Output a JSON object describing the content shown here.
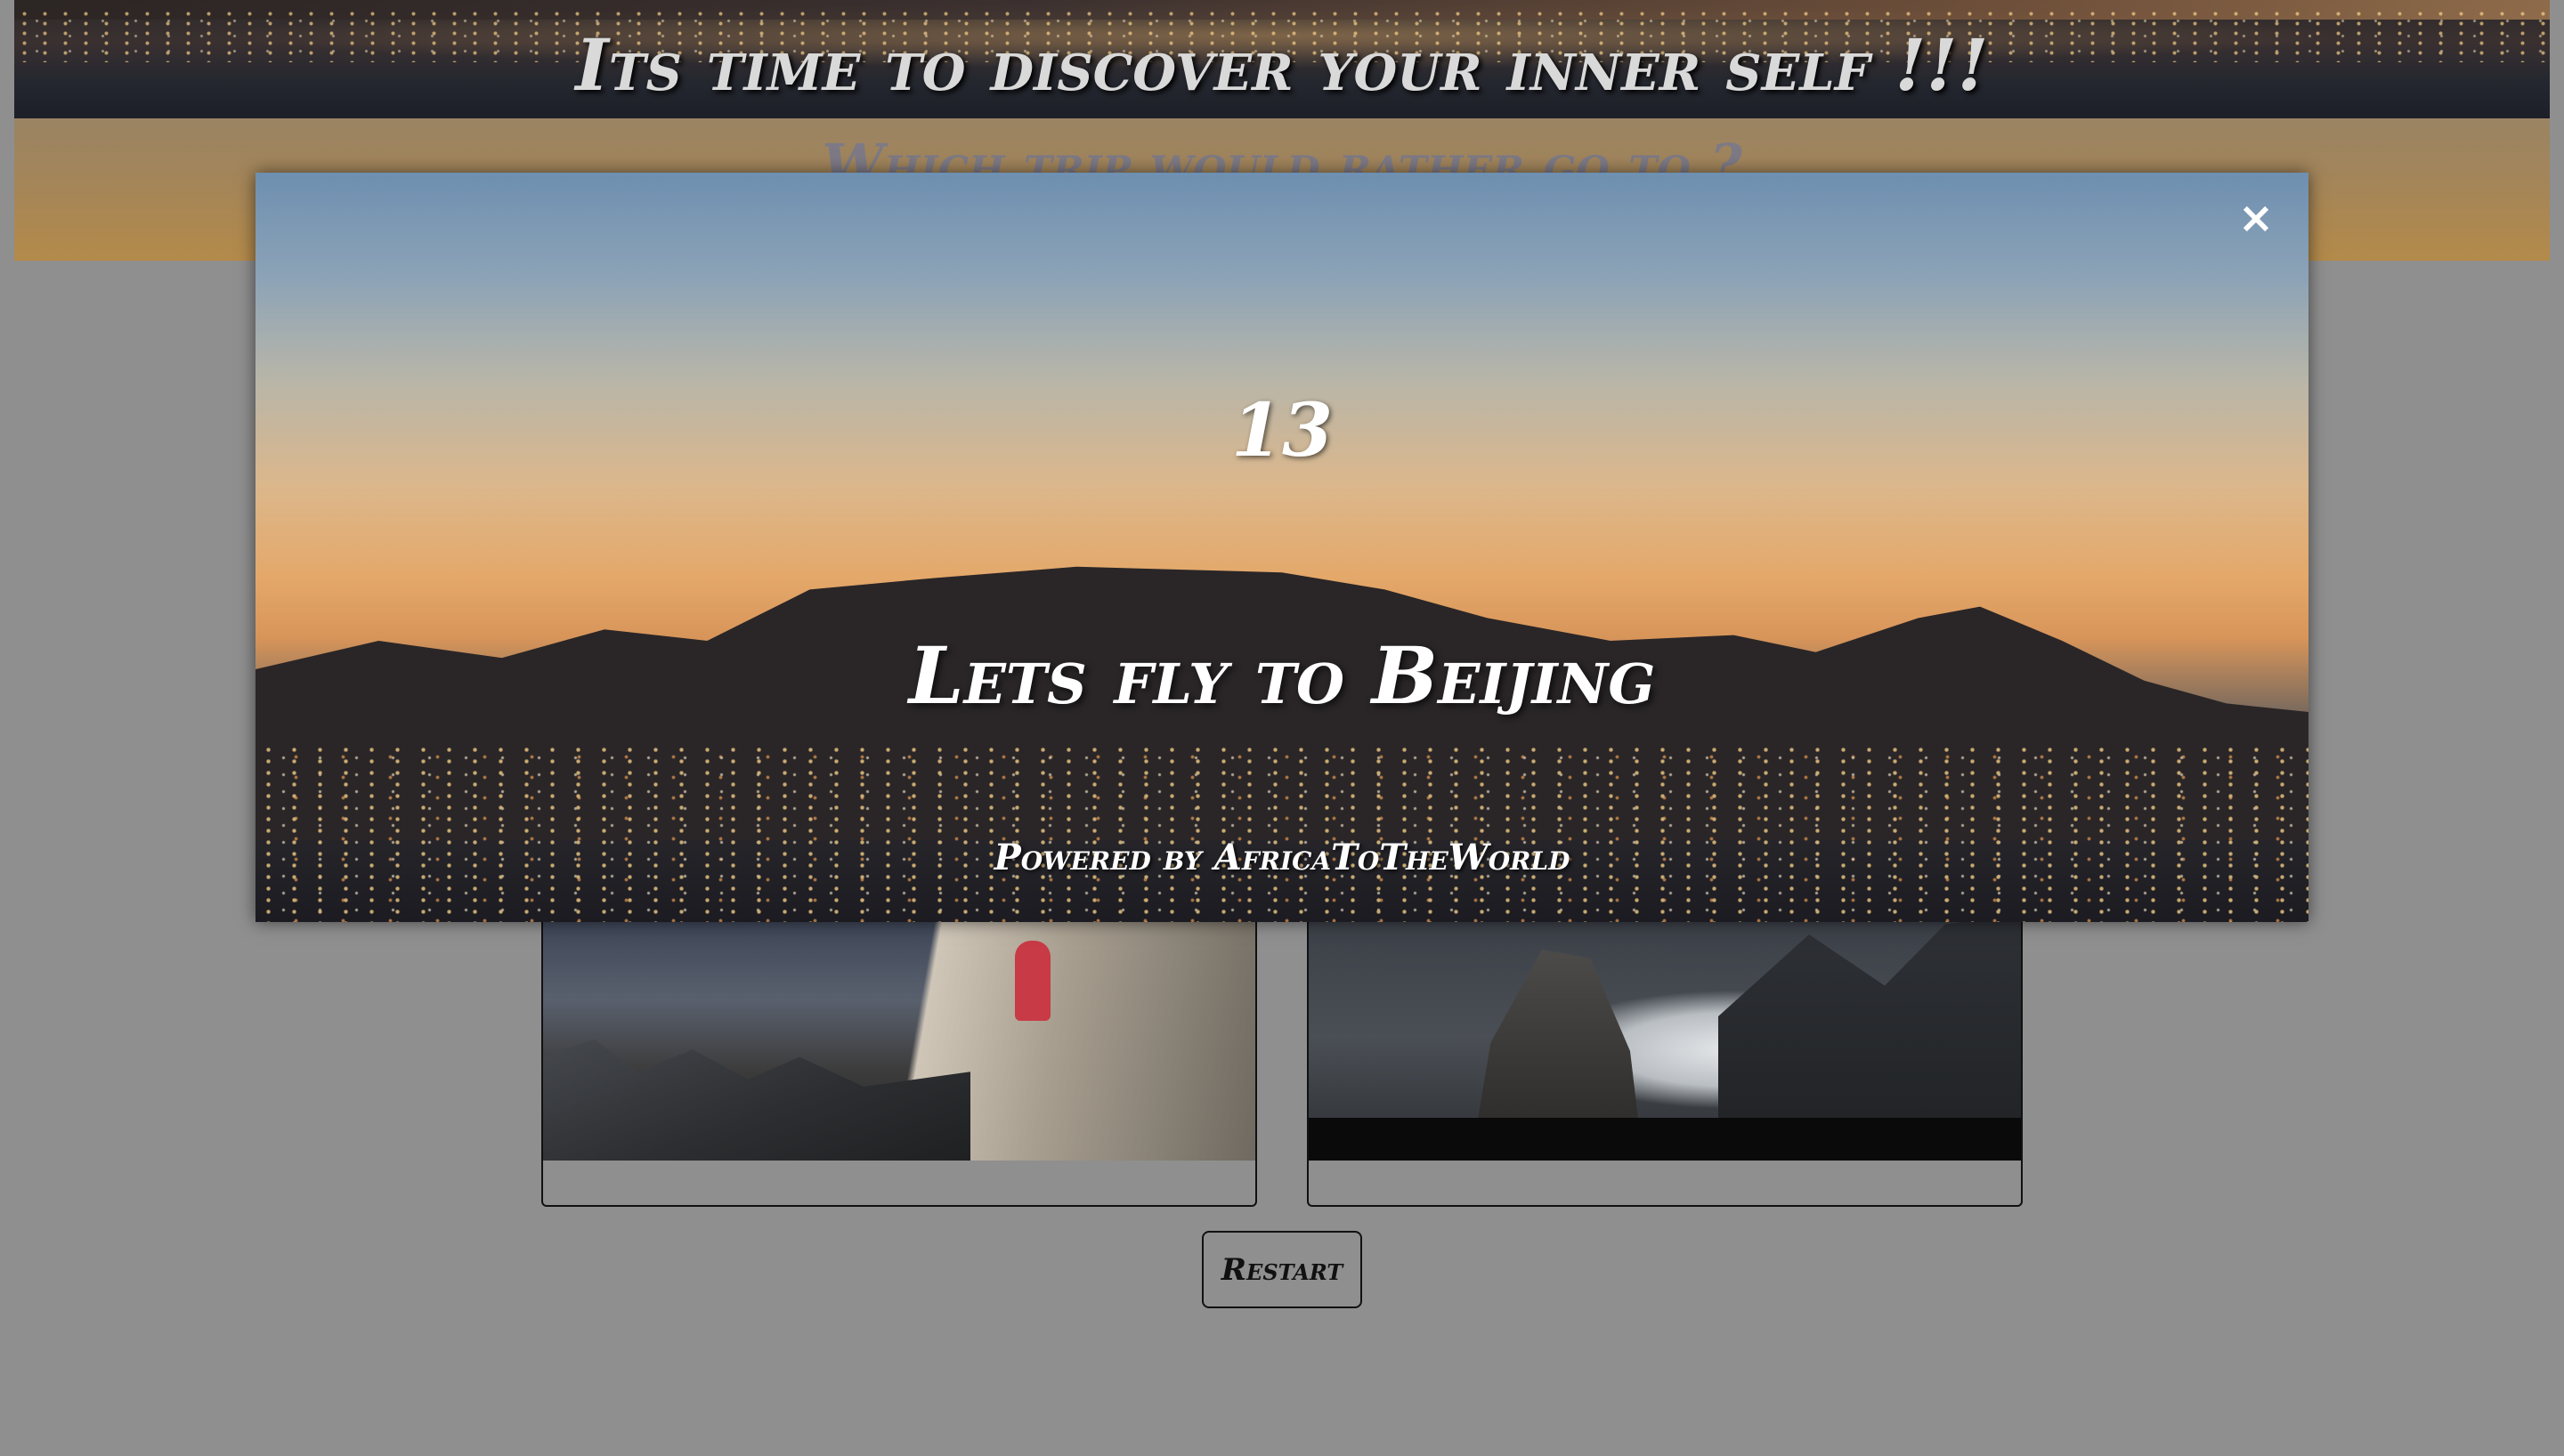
{
  "header": {
    "title": "Its time to discover your inner self !!!",
    "subtitle": "Which trip would rather go to ?"
  },
  "controls": {
    "restart_label": "Restart"
  },
  "modal": {
    "close_icon": "×",
    "number": "13",
    "headline": "Lets fly to Beijing",
    "powered_by": "Powered by AfricaToTheWorld"
  },
  "icons": {
    "close": "close-icon"
  }
}
